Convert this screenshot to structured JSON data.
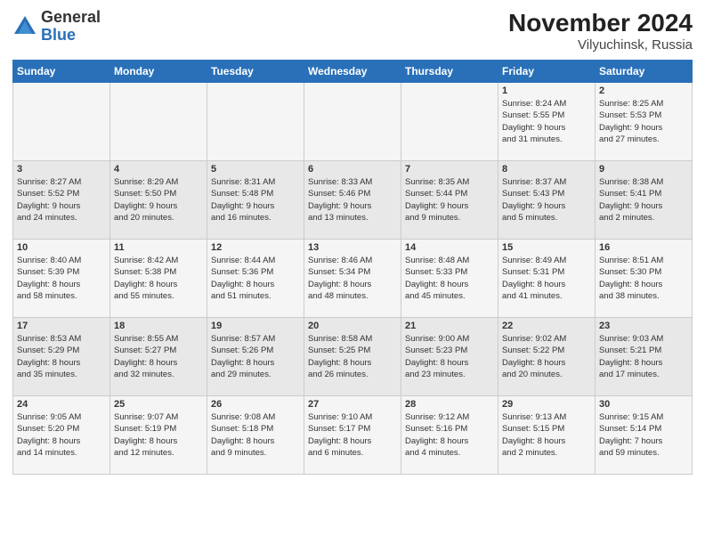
{
  "header": {
    "logo_general": "General",
    "logo_blue": "Blue",
    "month_title": "November 2024",
    "location": "Vilyuchinsk, Russia"
  },
  "weekdays": [
    "Sunday",
    "Monday",
    "Tuesday",
    "Wednesday",
    "Thursday",
    "Friday",
    "Saturday"
  ],
  "weeks": [
    [
      {
        "day": "",
        "info": ""
      },
      {
        "day": "",
        "info": ""
      },
      {
        "day": "",
        "info": ""
      },
      {
        "day": "",
        "info": ""
      },
      {
        "day": "",
        "info": ""
      },
      {
        "day": "1",
        "info": "Sunrise: 8:24 AM\nSunset: 5:55 PM\nDaylight: 9 hours\nand 31 minutes."
      },
      {
        "day": "2",
        "info": "Sunrise: 8:25 AM\nSunset: 5:53 PM\nDaylight: 9 hours\nand 27 minutes."
      }
    ],
    [
      {
        "day": "3",
        "info": "Sunrise: 8:27 AM\nSunset: 5:52 PM\nDaylight: 9 hours\nand 24 minutes."
      },
      {
        "day": "4",
        "info": "Sunrise: 8:29 AM\nSunset: 5:50 PM\nDaylight: 9 hours\nand 20 minutes."
      },
      {
        "day": "5",
        "info": "Sunrise: 8:31 AM\nSunset: 5:48 PM\nDaylight: 9 hours\nand 16 minutes."
      },
      {
        "day": "6",
        "info": "Sunrise: 8:33 AM\nSunset: 5:46 PM\nDaylight: 9 hours\nand 13 minutes."
      },
      {
        "day": "7",
        "info": "Sunrise: 8:35 AM\nSunset: 5:44 PM\nDaylight: 9 hours\nand 9 minutes."
      },
      {
        "day": "8",
        "info": "Sunrise: 8:37 AM\nSunset: 5:43 PM\nDaylight: 9 hours\nand 5 minutes."
      },
      {
        "day": "9",
        "info": "Sunrise: 8:38 AM\nSunset: 5:41 PM\nDaylight: 9 hours\nand 2 minutes."
      }
    ],
    [
      {
        "day": "10",
        "info": "Sunrise: 8:40 AM\nSunset: 5:39 PM\nDaylight: 8 hours\nand 58 minutes."
      },
      {
        "day": "11",
        "info": "Sunrise: 8:42 AM\nSunset: 5:38 PM\nDaylight: 8 hours\nand 55 minutes."
      },
      {
        "day": "12",
        "info": "Sunrise: 8:44 AM\nSunset: 5:36 PM\nDaylight: 8 hours\nand 51 minutes."
      },
      {
        "day": "13",
        "info": "Sunrise: 8:46 AM\nSunset: 5:34 PM\nDaylight: 8 hours\nand 48 minutes."
      },
      {
        "day": "14",
        "info": "Sunrise: 8:48 AM\nSunset: 5:33 PM\nDaylight: 8 hours\nand 45 minutes."
      },
      {
        "day": "15",
        "info": "Sunrise: 8:49 AM\nSunset: 5:31 PM\nDaylight: 8 hours\nand 41 minutes."
      },
      {
        "day": "16",
        "info": "Sunrise: 8:51 AM\nSunset: 5:30 PM\nDaylight: 8 hours\nand 38 minutes."
      }
    ],
    [
      {
        "day": "17",
        "info": "Sunrise: 8:53 AM\nSunset: 5:29 PM\nDaylight: 8 hours\nand 35 minutes."
      },
      {
        "day": "18",
        "info": "Sunrise: 8:55 AM\nSunset: 5:27 PM\nDaylight: 8 hours\nand 32 minutes."
      },
      {
        "day": "19",
        "info": "Sunrise: 8:57 AM\nSunset: 5:26 PM\nDaylight: 8 hours\nand 29 minutes."
      },
      {
        "day": "20",
        "info": "Sunrise: 8:58 AM\nSunset: 5:25 PM\nDaylight: 8 hours\nand 26 minutes."
      },
      {
        "day": "21",
        "info": "Sunrise: 9:00 AM\nSunset: 5:23 PM\nDaylight: 8 hours\nand 23 minutes."
      },
      {
        "day": "22",
        "info": "Sunrise: 9:02 AM\nSunset: 5:22 PM\nDaylight: 8 hours\nand 20 minutes."
      },
      {
        "day": "23",
        "info": "Sunrise: 9:03 AM\nSunset: 5:21 PM\nDaylight: 8 hours\nand 17 minutes."
      }
    ],
    [
      {
        "day": "24",
        "info": "Sunrise: 9:05 AM\nSunset: 5:20 PM\nDaylight: 8 hours\nand 14 minutes."
      },
      {
        "day": "25",
        "info": "Sunrise: 9:07 AM\nSunset: 5:19 PM\nDaylight: 8 hours\nand 12 minutes."
      },
      {
        "day": "26",
        "info": "Sunrise: 9:08 AM\nSunset: 5:18 PM\nDaylight: 8 hours\nand 9 minutes."
      },
      {
        "day": "27",
        "info": "Sunrise: 9:10 AM\nSunset: 5:17 PM\nDaylight: 8 hours\nand 6 minutes."
      },
      {
        "day": "28",
        "info": "Sunrise: 9:12 AM\nSunset: 5:16 PM\nDaylight: 8 hours\nand 4 minutes."
      },
      {
        "day": "29",
        "info": "Sunrise: 9:13 AM\nSunset: 5:15 PM\nDaylight: 8 hours\nand 2 minutes."
      },
      {
        "day": "30",
        "info": "Sunrise: 9:15 AM\nSunset: 5:14 PM\nDaylight: 7 hours\nand 59 minutes."
      }
    ]
  ]
}
